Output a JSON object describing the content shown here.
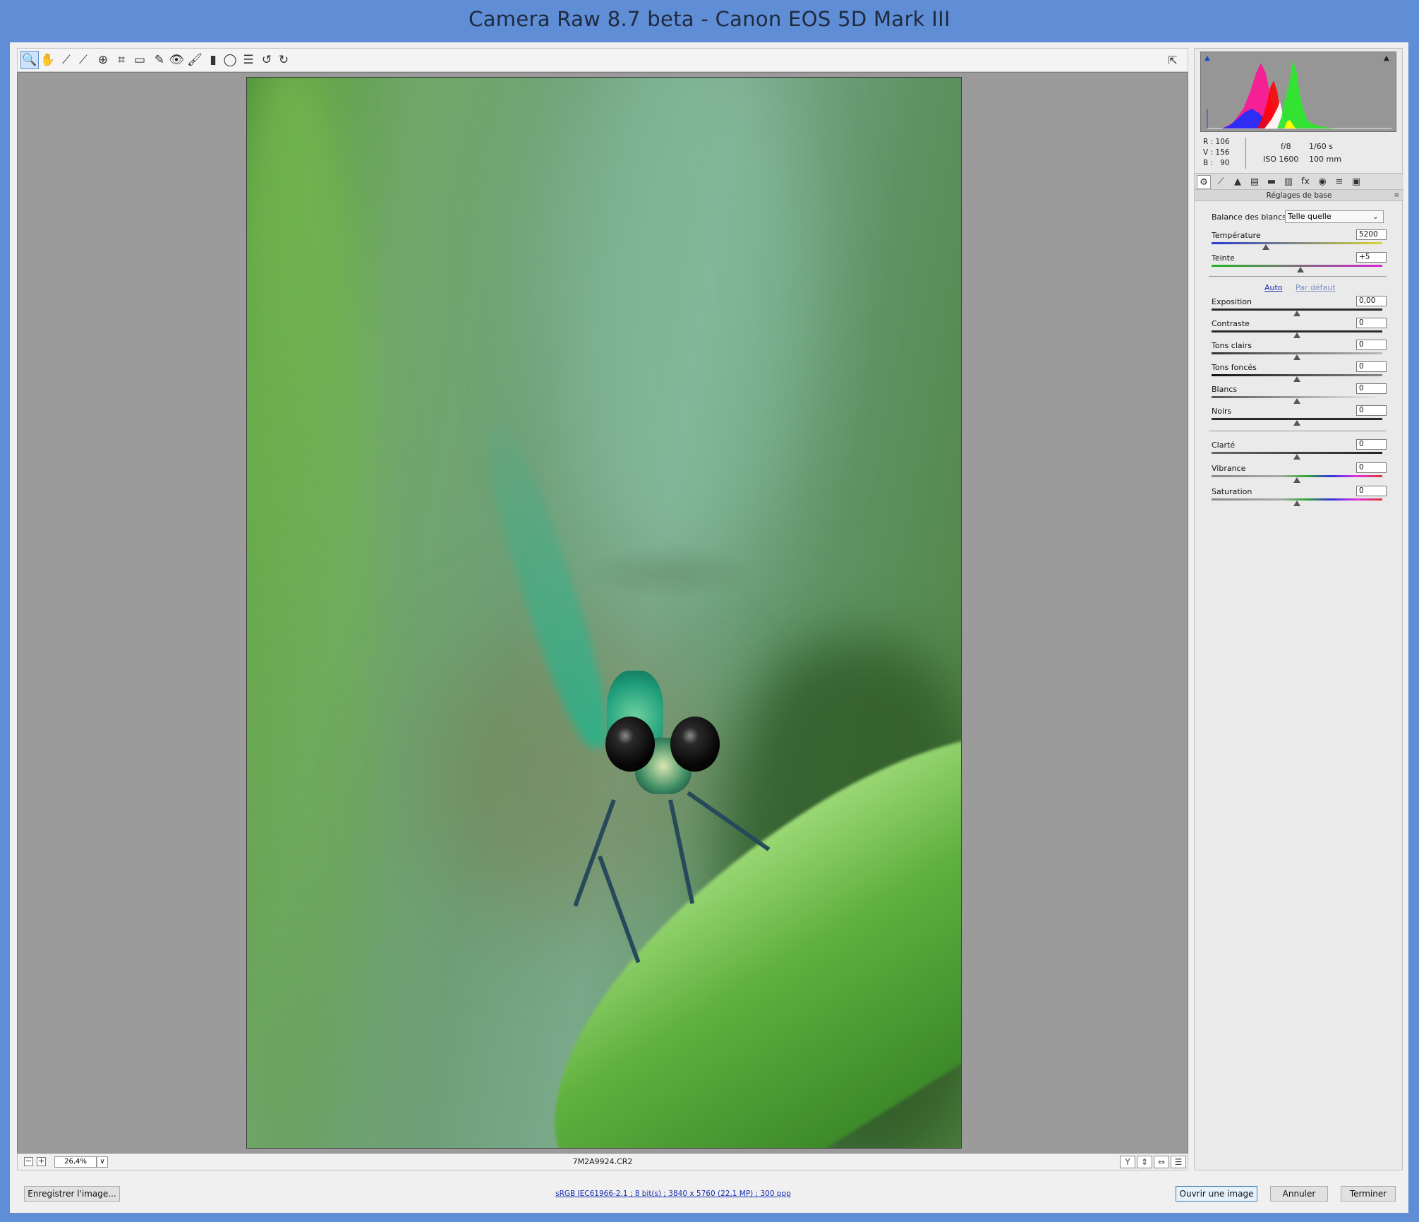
{
  "window": {
    "title": "Camera Raw 8.7 beta  -  Canon EOS 5D Mark III"
  },
  "toolbar": {
    "tools": [
      {
        "name": "zoom-tool",
        "icon": "🔍"
      },
      {
        "name": "hand-tool",
        "icon": "✋"
      },
      {
        "name": "white-balance-tool",
        "icon": "⟋"
      },
      {
        "name": "color-sampler-tool",
        "icon": "⟋"
      },
      {
        "name": "targeted-adjustment-tool",
        "icon": "⊕"
      },
      {
        "name": "crop-tool",
        "icon": "⌗"
      },
      {
        "name": "straighten-tool",
        "icon": "▭"
      },
      {
        "name": "spot-removal-tool",
        "icon": "✎"
      },
      {
        "name": "red-eye-tool",
        "icon": "👁"
      },
      {
        "name": "adjustment-brush-tool",
        "icon": "🖌"
      },
      {
        "name": "graduated-filter-tool",
        "icon": "▮"
      },
      {
        "name": "radial-filter-tool",
        "icon": "◯"
      },
      {
        "name": "preferences-tool",
        "icon": "☰"
      },
      {
        "name": "rotate-left-tool",
        "icon": "↺"
      },
      {
        "name": "rotate-right-tool",
        "icon": "↻"
      }
    ],
    "fullscreen_icon": "⇱"
  },
  "status": {
    "zoom_out": "−",
    "zoom_in": "+",
    "zoom_value": "26,4%",
    "zoom_dropdown": "∨",
    "filename": "7M2A9924.CR2",
    "view_icons": [
      "Y",
      "⇕",
      "⇔",
      "☰"
    ]
  },
  "histogram": {
    "readout": {
      "r_label": "R :",
      "r": "106",
      "v_label": "V :",
      "v": "156",
      "b_label": "B :",
      "b": "90"
    },
    "aperture": "f/8",
    "shutter": "1/60 s",
    "iso": "ISO 1600",
    "focal": "100 mm",
    "clip_shadow_icon": "▲",
    "clip_highlight_icon": "▲"
  },
  "panel_tabs": [
    "⚙",
    "⟋",
    "▲",
    "▤",
    "▬",
    "▥",
    "fx",
    "◉",
    "≡",
    "▣"
  ],
  "section": {
    "title": "Réglages de base",
    "menu_icon": "≡"
  },
  "white_balance": {
    "label": "Balance des blancs :",
    "value": "Telle quelle",
    "chevron": "⌄"
  },
  "links": {
    "auto": "Auto",
    "default": "Par défaut"
  },
  "sliders": {
    "temperature": {
      "label": "Température",
      "value": "5200",
      "level": 0.32
    },
    "tint": {
      "label": "Teinte",
      "value": "+5",
      "level": 0.52
    },
    "exposure": {
      "label": "Exposition",
      "value": "0,00",
      "level": 0.5
    },
    "contrast": {
      "label": "Contraste",
      "value": "0",
      "level": 0.5
    },
    "highlights": {
      "label": "Tons clairs",
      "value": "0",
      "level": 0.5
    },
    "shadows": {
      "label": "Tons foncés",
      "value": "0",
      "level": 0.5
    },
    "whites": {
      "label": "Blancs",
      "value": "0",
      "level": 0.5
    },
    "blacks": {
      "label": "Noirs",
      "value": "0",
      "level": 0.5
    },
    "clarity": {
      "label": "Clarté",
      "value": "0",
      "level": 0.5
    },
    "vibrance": {
      "label": "Vibrance",
      "value": "0",
      "level": 0.5
    },
    "saturation": {
      "label": "Saturation",
      "value": "0",
      "level": 0.5
    }
  },
  "bottom": {
    "save": "Enregistrer l'image...",
    "workflow": "sRGB IEC61966-2.1 ; 8 bit(s) ; 3840 x 5760 (22,1 MP) ; 300 ppp",
    "open": "Ouvrir une image",
    "cancel": "Annuler",
    "done": "Terminer"
  },
  "colors": {
    "title_bar": "#5f8dd6",
    "accent": "#1a2fb0",
    "preview_bg": "#9b9b9b"
  }
}
